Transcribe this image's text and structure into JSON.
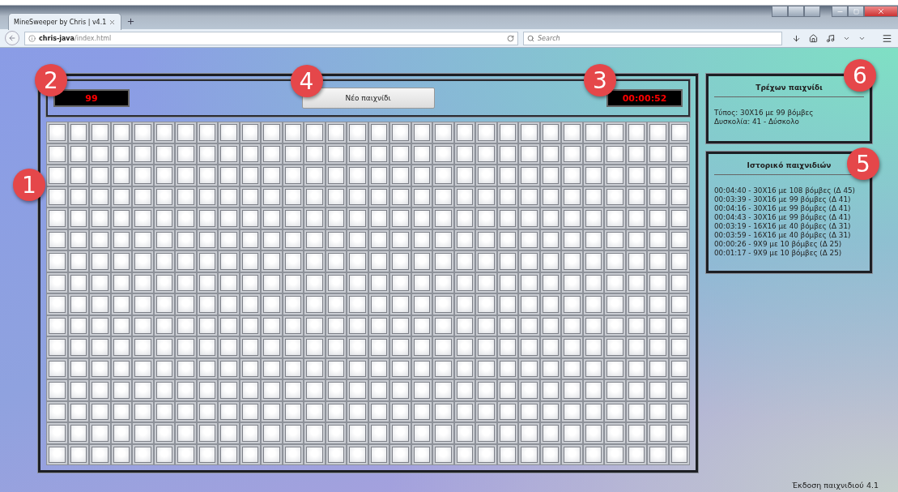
{
  "browser": {
    "tab": {
      "title": "MineSweeper by Chris | v4.1",
      "selected": true
    },
    "url": {
      "host": "chris-java",
      "path": "/index.html"
    },
    "search": {
      "placeholder": "Search"
    }
  },
  "game": {
    "mines_counter": {
      "value": "99",
      "marker": "2"
    },
    "new_game_button": {
      "label": "Νέο παιχνίδι",
      "marker": "4"
    },
    "timer": {
      "value": "00:00:52",
      "marker": "3"
    },
    "grid": {
      "marker": "1",
      "rows": [
        {
          "covered": [
            true,
            true,
            true,
            true,
            true,
            true,
            true,
            true,
            true,
            true,
            true,
            true,
            true,
            true,
            true,
            true,
            true,
            true,
            true,
            true,
            true,
            true,
            true,
            true,
            true,
            true,
            true,
            true,
            true,
            true
          ]
        },
        {
          "covered": [
            true,
            true,
            true,
            true,
            true,
            true,
            true,
            true,
            true,
            true,
            true,
            true,
            true,
            true,
            true,
            true,
            true,
            true,
            true,
            true,
            true,
            true,
            true,
            true,
            true,
            true,
            true,
            true,
            true,
            true
          ]
        },
        {
          "covered": [
            true,
            true,
            true,
            true,
            true,
            true,
            true,
            true,
            true,
            true,
            true,
            true,
            true,
            true,
            true,
            true,
            true,
            true,
            true,
            true,
            true,
            true,
            true,
            true,
            true,
            true,
            true,
            true,
            true,
            true
          ]
        },
        {
          "covered": [
            true,
            true,
            true,
            true,
            true,
            true,
            true,
            true,
            true,
            true,
            true,
            true,
            true,
            true,
            true,
            true,
            true,
            true,
            true,
            true,
            true,
            true,
            true,
            true,
            true,
            true,
            true,
            true,
            true,
            true
          ]
        },
        {
          "covered": [
            true,
            true,
            true,
            true,
            true,
            true,
            true,
            true,
            true,
            true,
            true,
            true,
            true,
            true,
            true,
            true,
            true,
            true,
            true,
            true,
            true,
            true,
            true,
            true,
            true,
            true,
            true,
            true,
            true,
            true
          ]
        },
        {
          "covered": [
            true,
            true,
            true,
            true,
            true,
            true,
            true,
            true,
            true,
            true,
            true,
            true,
            true,
            true,
            true,
            true,
            true,
            true,
            true,
            true,
            true,
            true,
            true,
            true,
            true,
            true,
            true,
            true,
            true,
            true
          ]
        },
        {
          "covered": [
            true,
            true,
            true,
            true,
            true,
            true,
            true,
            true,
            true,
            true,
            true,
            true,
            true,
            true,
            true,
            true,
            true,
            true,
            true,
            true,
            true,
            true,
            true,
            true,
            true,
            true,
            true,
            true,
            true,
            true
          ]
        },
        {
          "covered": [
            true,
            true,
            true,
            true,
            true,
            true,
            true,
            true,
            true,
            true,
            true,
            true,
            true,
            true,
            true,
            true,
            true,
            true,
            true,
            true,
            true,
            true,
            true,
            true,
            true,
            true,
            true,
            true,
            true,
            true
          ]
        },
        {
          "covered": [
            true,
            true,
            true,
            true,
            true,
            true,
            true,
            true,
            true,
            true,
            true,
            true,
            true,
            true,
            true,
            true,
            true,
            true,
            true,
            true,
            true,
            true,
            true,
            true,
            true,
            true,
            true,
            true,
            true,
            true
          ]
        },
        {
          "covered": [
            true,
            true,
            true,
            true,
            true,
            true,
            true,
            true,
            true,
            true,
            true,
            true,
            true,
            true,
            true,
            true,
            true,
            true,
            true,
            true,
            true,
            true,
            true,
            true,
            true,
            true,
            true,
            true,
            true,
            true
          ]
        },
        {
          "covered": [
            true,
            true,
            true,
            true,
            true,
            true,
            true,
            true,
            true,
            true,
            true,
            true,
            true,
            true,
            true,
            true,
            true,
            true,
            true,
            true,
            true,
            true,
            true,
            true,
            true,
            true,
            true,
            true,
            true,
            true
          ]
        },
        {
          "covered": [
            true,
            true,
            true,
            true,
            true,
            true,
            true,
            true,
            true,
            true,
            true,
            true,
            true,
            true,
            true,
            true,
            true,
            true,
            true,
            true,
            true,
            true,
            true,
            true,
            true,
            true,
            true,
            true,
            true,
            true
          ]
        },
        {
          "covered": [
            true,
            true,
            true,
            true,
            true,
            true,
            true,
            true,
            true,
            true,
            true,
            true,
            true,
            true,
            true,
            true,
            true,
            true,
            true,
            true,
            true,
            true,
            true,
            true,
            true,
            true,
            true,
            true,
            true,
            true
          ]
        },
        {
          "covered": [
            true,
            true,
            true,
            true,
            true,
            true,
            true,
            true,
            true,
            true,
            true,
            true,
            true,
            true,
            true,
            true,
            true,
            true,
            true,
            true,
            true,
            true,
            true,
            true,
            true,
            true,
            true,
            true,
            true,
            true
          ]
        },
        {
          "covered": [
            true,
            true,
            true,
            true,
            true,
            true,
            true,
            true,
            true,
            true,
            true,
            true,
            true,
            true,
            true,
            true,
            true,
            true,
            true,
            true,
            true,
            true,
            true,
            true,
            true,
            true,
            true,
            true,
            true,
            true
          ]
        },
        {
          "covered": [
            true,
            true,
            true,
            true,
            true,
            true,
            true,
            true,
            true,
            true,
            true,
            true,
            true,
            true,
            true,
            true,
            true,
            true,
            true,
            true,
            true,
            true,
            true,
            true,
            true,
            true,
            true,
            true,
            true,
            true
          ]
        }
      ]
    }
  },
  "current_game": {
    "title": "Τρέχων παιχνίδι",
    "marker": "6",
    "lines": [
      "Τύπος: 30X16 με 99 βόμβες",
      "Δυσκολία: 41 - Δύσκολο"
    ]
  },
  "history": {
    "title": "Ιστορικό παιχνιδιών",
    "marker": "5",
    "entries": [
      "00:04:40 - 30X16 με 108 βόμβες (Δ 45)",
      "00:03:39 - 30X16 με 99 βόμβες (Δ 41)",
      "00:04:16 - 30X16 με 99 βόμβες (Δ 41)",
      "00:04:43 - 30X16 με 99 βόμβες (Δ 41)",
      "00:03:19 - 16X16 με 40 βόμβες (Δ 31)",
      "00:03:59 - 16X16 με 40 βόμβες (Δ 31)",
      "00:00:26 - 9X9 με 10 βόμβες (Δ 25)",
      "00:01:17 - 9X9 με 10 βόμβες (Δ 25)"
    ]
  },
  "footer": {
    "version": "Έκδοση παιχνιδιού 4.1"
  }
}
